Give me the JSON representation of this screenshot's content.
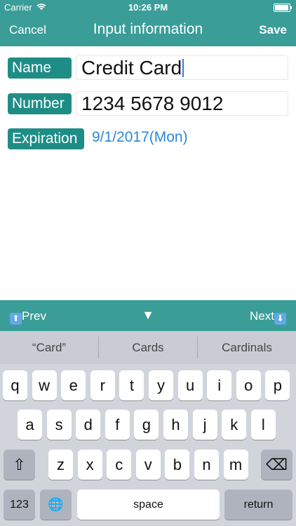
{
  "status_bar": {
    "carrier": "Carrier",
    "time": "10:26 PM",
    "battery_level": 0.95
  },
  "nav": {
    "cancel_label": "Cancel",
    "title": "Input information",
    "save_label": "Save"
  },
  "form": {
    "name_label": "Name",
    "name_value": "Credit Card",
    "number_label": "Number",
    "number_value": "1234 5678 9012",
    "expiration_label": "Expiration",
    "expiration_value": "9/1/2017(Mon)"
  },
  "accessory": {
    "prev_label": "Prev",
    "next_label": "Next",
    "dismiss_glyph": "▼",
    "prev_icon_glyph": "⬆",
    "next_icon_glyph": "⬇"
  },
  "suggestions": [
    "“Card”",
    "Cards",
    "Cardinals"
  ],
  "keyboard": {
    "row1": [
      "q",
      "w",
      "e",
      "r",
      "t",
      "y",
      "u",
      "i",
      "o",
      "p"
    ],
    "row2": [
      "a",
      "s",
      "d",
      "f",
      "g",
      "h",
      "j",
      "k",
      "l"
    ],
    "row3": [
      "z",
      "x",
      "c",
      "v",
      "b",
      "n",
      "m"
    ],
    "shift_glyph": "⇧",
    "delete_glyph": "⌫",
    "globe_glyph": "🌐",
    "numbers_label": "123",
    "space_label": "space",
    "return_label": "return"
  },
  "colors": {
    "accent": "#3a9d98",
    "label_bg": "#1e8d86",
    "date_text": "#2b88d8",
    "keyboard_bg": "#d1d5db"
  }
}
